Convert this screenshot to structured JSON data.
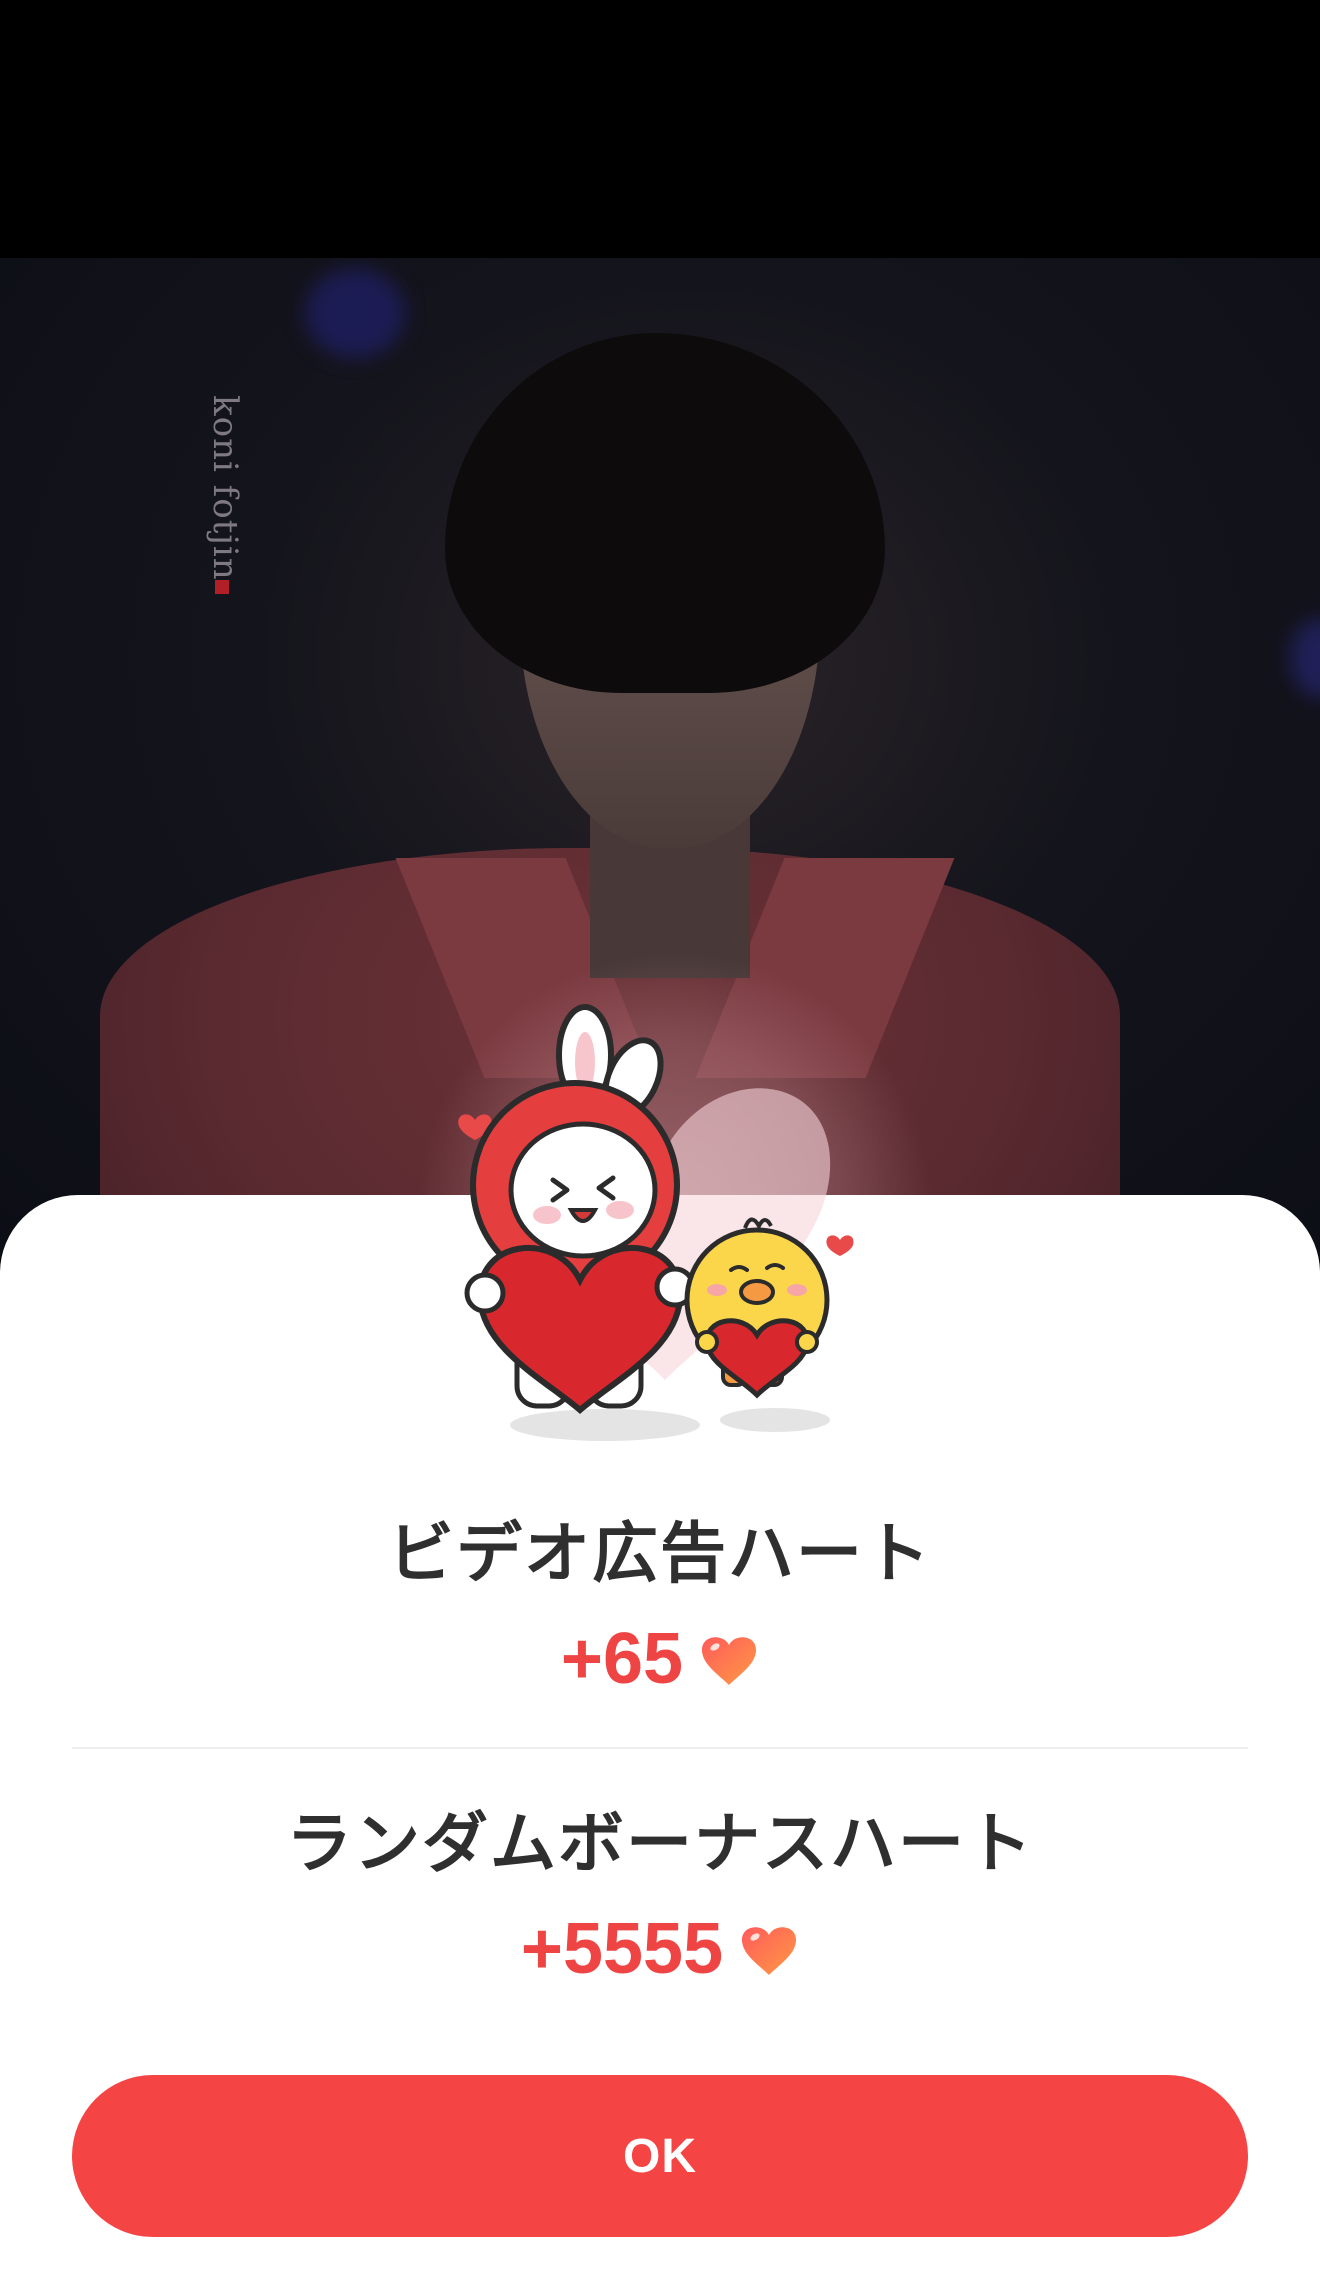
{
  "background_photo": {
    "watermark": "koni fotjin"
  },
  "dialog": {
    "reward_items": [
      {
        "label": "ビデオ広告ハート",
        "amount": "+65"
      },
      {
        "label": "ランダムボーナスハート",
        "amount": "+5555"
      }
    ],
    "ok_label": "OK"
  },
  "colors": {
    "accent": "#f44444",
    "reward_text": "#ee4444",
    "title_text": "#2f2f2f",
    "sheet_bg": "#ffffff",
    "top_bar": "#000000"
  },
  "icons": {
    "reward_icon": "heart-icon",
    "mascot": "bunny-and-chick-holding-hearts"
  }
}
